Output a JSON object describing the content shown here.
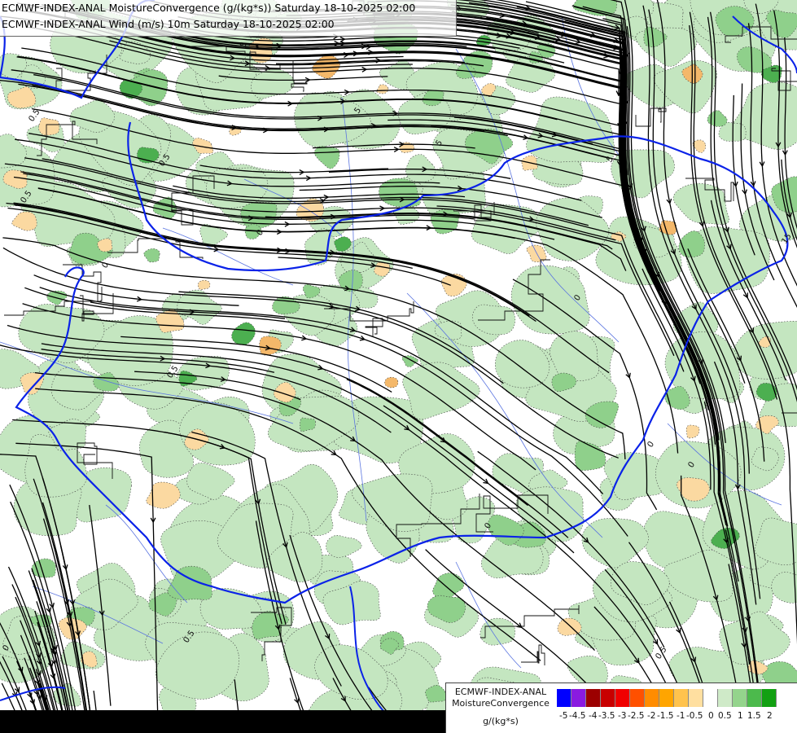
{
  "header": {
    "line1": "ECMWF-INDEX-ANAL MoistureConvergence (g/(kg*s)) Saturday 18-10-2025 02:00",
    "line2": "ECMWF-INDEX-ANAL Wind (m/s) 10m Saturday 18-10-2025 02:00"
  },
  "map": {
    "contour_labels": [
      "0",
      "0.5",
      "-0.5",
      "5",
      "-5",
      "15"
    ],
    "colors": {
      "convergence_light": "#c4e6c0",
      "convergence_mid": "#8fd08b",
      "convergence_strong": "#4caf50",
      "divergence_light": "#fbd9a1",
      "divergence_mid": "#f4b86a",
      "border": "#0a22e8",
      "rivers": "#5a74e0",
      "streamline": "#000000"
    }
  },
  "legend": {
    "title_line1": "ECMWF-INDEX-ANAL",
    "title_line2": "MoistureConvergence",
    "unit": "g/(kg*s)",
    "ticks": [
      "-5",
      "-4.5",
      "-4",
      "-3.5",
      "-3",
      "-2.5",
      "-2",
      "-1.5",
      "-1",
      "-0.5",
      "0",
      "0.5",
      "1",
      "1.5",
      "2"
    ],
    "swatch_colors": [
      "#0000ff",
      "#8a1be0",
      "#9c0000",
      "#c80000",
      "#f00000",
      "#ff5000",
      "#ff8c00",
      "#ffa500",
      "#ffc34d",
      "#ffdfa0",
      "#ffffff",
      "#cfeac8",
      "#94d48c",
      "#4cba4c",
      "#12a012"
    ]
  }
}
